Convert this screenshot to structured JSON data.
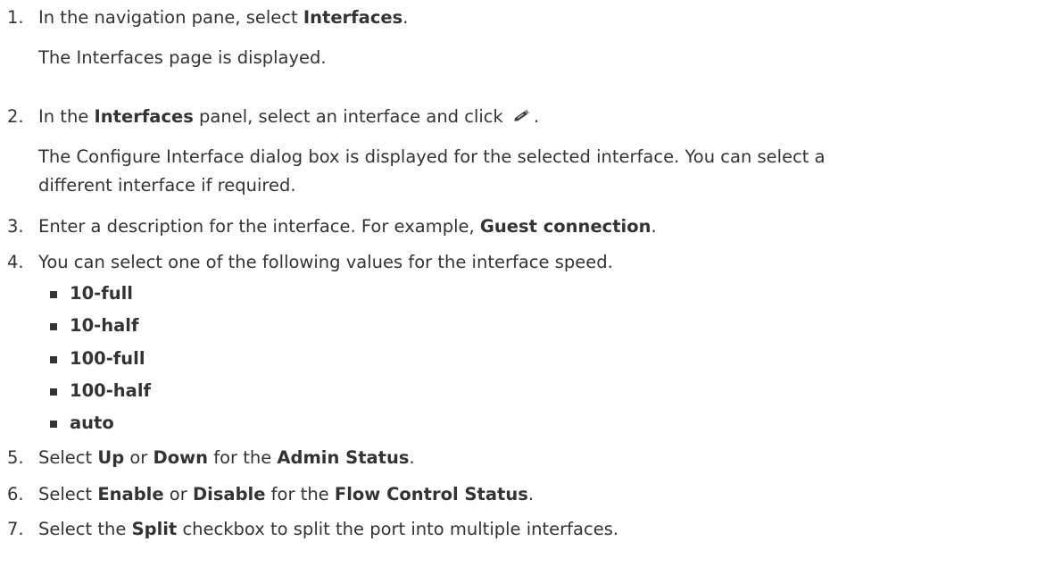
{
  "steps": [
    {
      "number": "1.",
      "parts": [
        "In the navigation pane, select ",
        "Interfaces",
        "."
      ],
      "result": "The Interfaces page is displayed."
    },
    {
      "number": "2.",
      "parts": [
        "In the ",
        "Interfaces",
        " panel, select an interface and click ",
        "."
      ],
      "result_line1": "The Configure Interface dialog box is displayed for the selected interface. You can select a",
      "result_line2": "different interface if required."
    },
    {
      "number": "3.",
      "parts": [
        "Enter a description for the interface. For example, ",
        "Guest connection",
        "."
      ]
    },
    {
      "number": "4.",
      "text": "You can select one of the following values for the interface speed.",
      "options": [
        "10-full",
        "10-half",
        "100-full",
        "100-half",
        "auto"
      ]
    },
    {
      "number": "5.",
      "parts": [
        "Select ",
        "Up",
        " or ",
        "Down",
        " for the ",
        "Admin Status",
        "."
      ]
    },
    {
      "number": "6.",
      "parts": [
        "Select ",
        "Enable",
        " or ",
        "Disable",
        " for the ",
        "Flow Control Status",
        "."
      ]
    },
    {
      "number": "7.",
      "parts": [
        "Select the ",
        "Split",
        " checkbox to split the port into multiple interfaces."
      ]
    }
  ],
  "icons": {
    "edit": "pencil-edit-icon"
  },
  "colors": {
    "text": "#333333",
    "background": "#ffffff"
  }
}
